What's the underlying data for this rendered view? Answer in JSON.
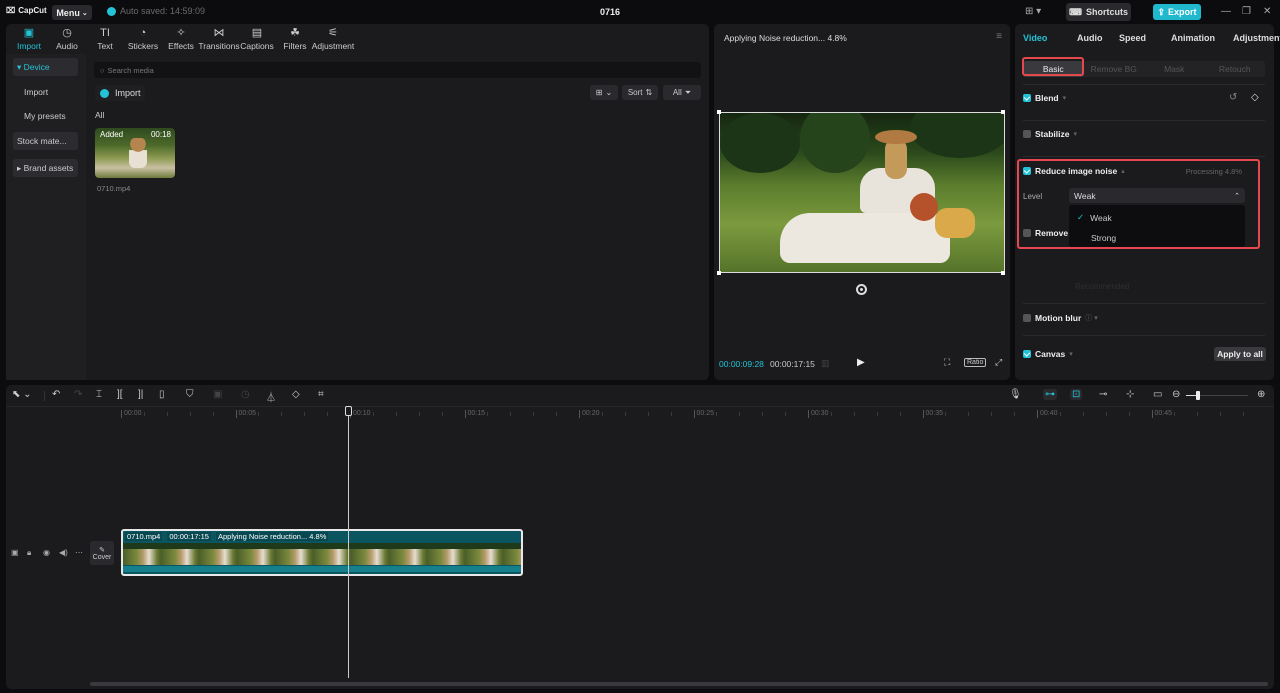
{
  "app": {
    "logo": "CapCut",
    "menu_label": "Menu",
    "autosave": "Auto saved: 14:59:09",
    "project_title": "0716",
    "shortcuts_label": "Shortcuts",
    "export_label": "Export"
  },
  "toolbar": [
    {
      "label": "Import",
      "icon": "import-icon",
      "glyph": "▣",
      "active": true
    },
    {
      "label": "Audio",
      "icon": "audio-icon",
      "glyph": "◷"
    },
    {
      "label": "Text",
      "icon": "text-icon",
      "glyph": "TI"
    },
    {
      "label": "Stickers",
      "icon": "stickers-icon",
      "glyph": "◔"
    },
    {
      "label": "Effects",
      "icon": "effects-icon",
      "glyph": "✧"
    },
    {
      "label": "Transitions",
      "icon": "transitions-icon",
      "glyph": "⋈"
    },
    {
      "label": "Captions",
      "icon": "captions-icon",
      "glyph": "▤"
    },
    {
      "label": "Filters",
      "icon": "filters-icon",
      "glyph": "☘"
    },
    {
      "label": "Adjustment",
      "icon": "adjustment-icon",
      "glyph": "⚟"
    }
  ],
  "sidebar": [
    {
      "label": "▾ Device",
      "active": true,
      "bg": true
    },
    {
      "label": "Import"
    },
    {
      "label": "My presets"
    },
    {
      "label": "Stock mate...",
      "bg": true
    },
    {
      "label": "▸ Brand assets",
      "bg": true
    }
  ],
  "media": {
    "search_placeholder": "Search media",
    "import_label": "Import",
    "sort_label": "Sort",
    "filter_label": "All",
    "section_label": "All",
    "items": [
      {
        "name": "0710.mp4",
        "badge": "Added",
        "duration": "00:18"
      }
    ]
  },
  "player": {
    "title": "Applying Noise reduction... 4.8%",
    "current_time": "00:00:09:28",
    "total_time": "00:00:17:15",
    "ratio_label": "Ratio"
  },
  "properties": {
    "tabs": [
      {
        "label": "Video",
        "active": true
      },
      {
        "label": "Audio"
      },
      {
        "label": "Speed"
      },
      {
        "label": "Animation"
      },
      {
        "label": "Adjustment"
      }
    ],
    "subtabs": [
      {
        "label": "Basic",
        "active": true
      },
      {
        "label": "Remove BG"
      },
      {
        "label": "Mask"
      },
      {
        "label": "Retouch"
      }
    ],
    "blend": {
      "label": "Blend",
      "checked": true
    },
    "stabilize": {
      "label": "Stabilize",
      "checked": false
    },
    "reduce_noise": {
      "label": "Reduce image noise",
      "checked": true,
      "status": "Processing 4.8%",
      "level_label": "Level",
      "level_value": "Weak",
      "options": [
        "Weak",
        "Strong"
      ],
      "selected": "Weak"
    },
    "remove_flicker": {
      "label": "Remove",
      "checked": false,
      "ghost_value": "Recommended"
    },
    "motion_blur": {
      "label": "Motion blur",
      "checked": false
    },
    "canvas": {
      "label": "Canvas",
      "checked": true
    },
    "apply_all_label": "Apply to all"
  },
  "timeline": {
    "ruler": [
      "00:00",
      "00:05",
      "00:10",
      "00:15",
      "00:20",
      "00:25",
      "00:30",
      "00:35",
      "00:40",
      "00:45"
    ],
    "cover_label": "Cover",
    "clip": {
      "name": "0710.mp4",
      "duration": "00:00:17:15",
      "status": "Applying Noise reduction... 4.8%"
    },
    "zoom_level": 0.1
  }
}
